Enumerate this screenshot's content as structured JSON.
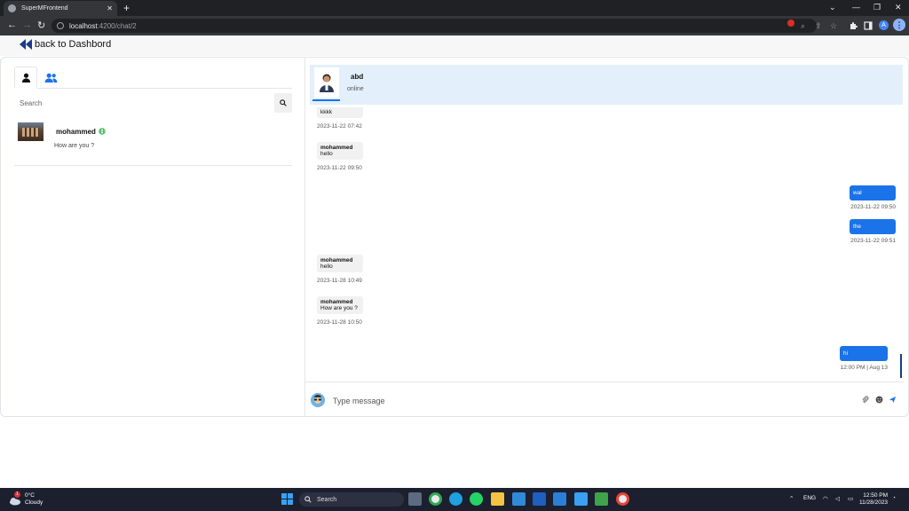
{
  "browser": {
    "tab_title": "SuperMFrontend",
    "url_host": "localhost",
    "url_path": ":4200/chat/2",
    "profile_initial": "A"
  },
  "page": {
    "back_label": "back to Dashbord"
  },
  "left_panel": {
    "search_placeholder": "Search",
    "contacts": [
      {
        "name": "mohammed",
        "preview": "How are you ?",
        "status": "online"
      }
    ]
  },
  "chat_header": {
    "name": "abd",
    "status": "online"
  },
  "messages": [
    {
      "direction": "in",
      "sender": "mohammed",
      "text": "kkkk",
      "time": "2023-11-22 07:42"
    },
    {
      "direction": "in",
      "sender": "mohammed",
      "text": "hello",
      "time": "2023-11-22 09:50"
    },
    {
      "direction": "out",
      "text": "wal",
      "time": "2023-11-22 09:50"
    },
    {
      "direction": "out",
      "text": "the",
      "time": "2023-11-22 09:51"
    },
    {
      "direction": "in",
      "sender": "mohammed",
      "text": "hello",
      "time": "2023-11-28 10:49"
    },
    {
      "direction": "in",
      "sender": "mohammed",
      "text": "How are you ?",
      "time": "2023-11-28 10:50"
    },
    {
      "direction": "out",
      "text": "hi",
      "time": "12:00 PM | Aug 13"
    }
  ],
  "composer": {
    "placeholder": "Type message"
  },
  "taskbar": {
    "weather_temp": "0°C",
    "weather_desc": "Cloudy",
    "weather_badge": "1",
    "search_label": "Search",
    "language": "ENG",
    "time": "12:50 PM",
    "date": "11/28/2023"
  },
  "colors": {
    "accent": "#1a73e8",
    "header_bg": "#e3f0fb",
    "online": "#2fb344",
    "back_arrow": "#1a3a8c"
  }
}
